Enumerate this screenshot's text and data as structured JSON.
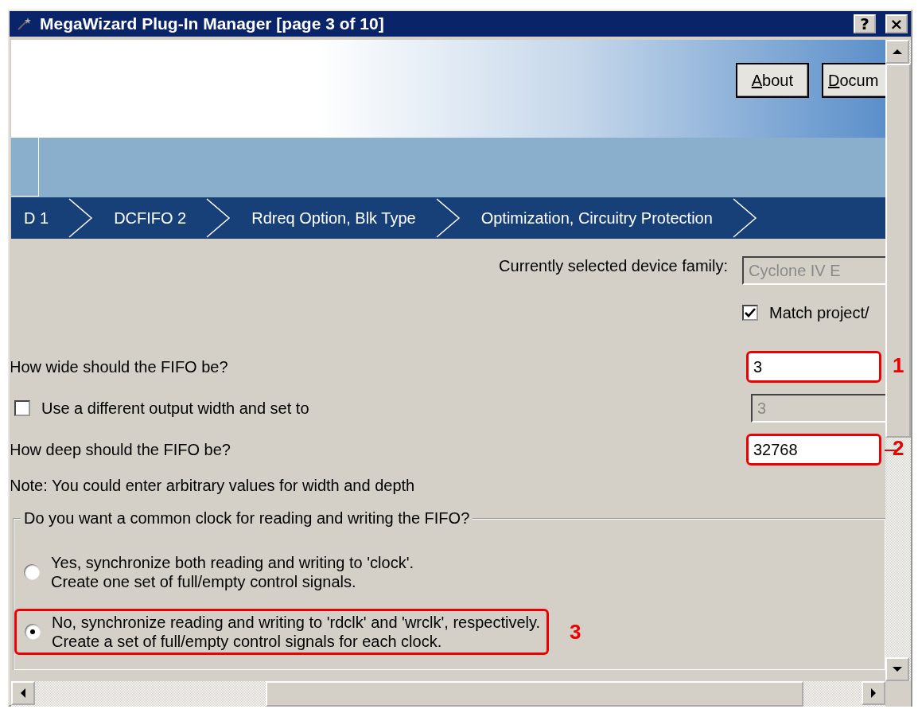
{
  "window": {
    "title": "MegaWizard Plug-In Manager [page 3 of 10]",
    "buttons": [
      {
        "label": "?"
      },
      {
        "label": "×"
      }
    ]
  },
  "header": {
    "buttons": [
      {
        "label": "About"
      },
      {
        "label": "Docum"
      }
    ]
  },
  "steps": [
    {
      "label": "D 1"
    },
    {
      "label": "DCFIFO 2"
    },
    {
      "label": "Rdreq Option, Blk Type"
    },
    {
      "label": "Optimization, Circuitry Protection"
    }
  ],
  "form": {
    "device_family": {
      "label": "Currently selected device family:",
      "value": "Cyclone IV E",
      "disabled": true
    },
    "match_project": {
      "label": "Match project/",
      "checked": true
    },
    "width": {
      "label": "How wide should the FIFO be?",
      "value": "3",
      "callout": "1"
    },
    "output_width": {
      "label": "Use a different output width and set to",
      "checked": false,
      "value": "3",
      "disabled": true
    },
    "depth": {
      "label": "How deep should the FIFO be?",
      "value": "32768",
      "callout": "2"
    },
    "note": "Note: You could enter arbitrary values for width and depth",
    "clock_group": {
      "legend": "Do you want a common clock for reading and writing the FIFO?",
      "options": [
        {
          "text": "Yes, synchronize both reading and writing to 'clock'.\nCreate one set of full/empty control signals.",
          "selected": false
        },
        {
          "text": "No, synchronize reading and writing to 'rdclk' and 'wrclk', respectively.\nCreate a set of full/empty control signals for each clock.",
          "selected": true,
          "callout": "3"
        }
      ]
    }
  }
}
